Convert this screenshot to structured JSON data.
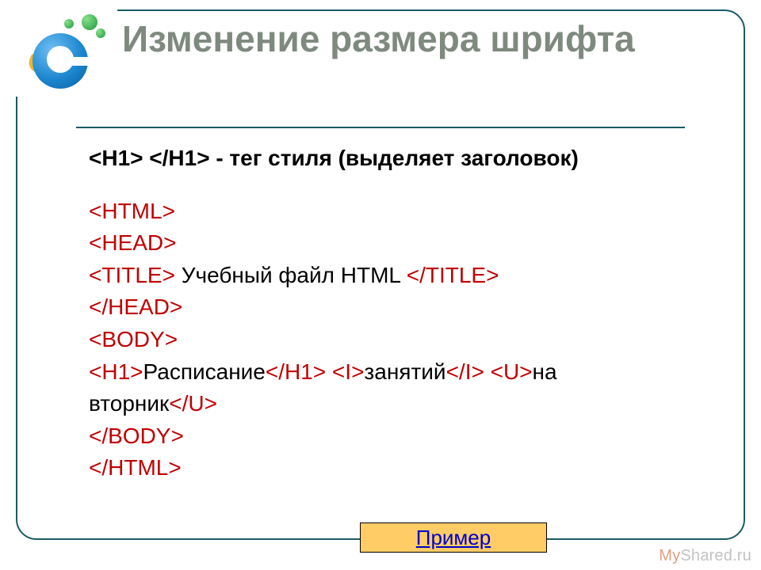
{
  "title": "Изменение размера шрифта",
  "subhead": " <H1> </H1> - тег стиля (выделяет заголовок)",
  "code": {
    "l1": "<HTML>",
    "l2": "<HEAD>",
    "l3a": "<TITLE>",
    "l3b": " Учебный файл HTML ",
    "l3c": "</TITLE>",
    "l4": "</HEAD>",
    "l5": "<BODY>",
    "l6a": "<H1>",
    "l6b": "Расписание",
    "l6c": "</H1>",
    "l6d": " <I>",
    "l6e": "занятий",
    "l6f": "</I>",
    "l6g": " <U>",
    "l6h": "на вторник",
    "l6i": "</U>",
    "l7": "</BODY>",
    "l8": "</HTML>"
  },
  "link_label": "Пример",
  "watermark": {
    "a": "My",
    "b": "Shared",
    "c": ".ru"
  },
  "colors": {
    "border": "#1b5a67",
    "title_text": "#7f8a7f",
    "tag_red": "#c00000",
    "link_bg": "#ffcc66",
    "link_text": "#0000cc"
  }
}
